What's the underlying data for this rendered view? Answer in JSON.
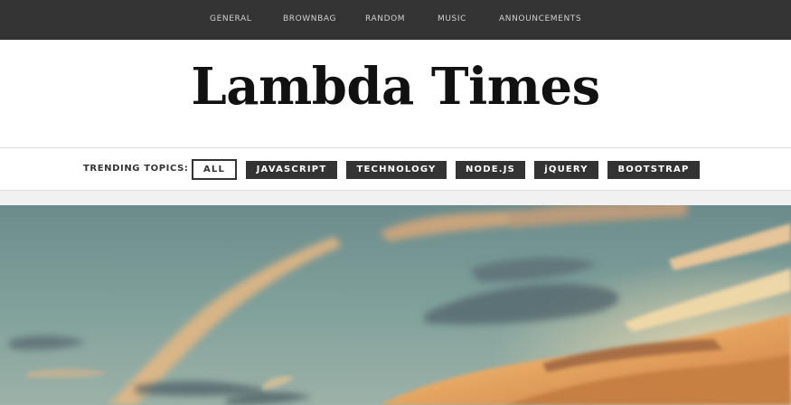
{
  "top_nav": {
    "items": [
      "GENERAL",
      "BROWNBAG",
      "RANDOM",
      "MUSIC",
      "ANNOUNCEMENTS"
    ]
  },
  "masthead": {
    "title": "Lambda Times"
  },
  "trending": {
    "label": "TRENDING TOPICS:",
    "tabs": [
      {
        "label": "ALL",
        "active": true
      },
      {
        "label": "JAVASCRIPT",
        "active": false
      },
      {
        "label": "TECHNOLOGY",
        "active": false
      },
      {
        "label": "NODE.JS",
        "active": false
      },
      {
        "label": "jQUERY",
        "active": false
      },
      {
        "label": "BOOTSTRAP",
        "active": false
      }
    ]
  },
  "hero": {
    "image_subject": "sunset-sky"
  },
  "colors": {
    "nav_background": "#333333",
    "nav_text": "#d2d2d2",
    "tab_background": "#333333",
    "tab_text": "#ffffff",
    "title_text": "#111111"
  }
}
